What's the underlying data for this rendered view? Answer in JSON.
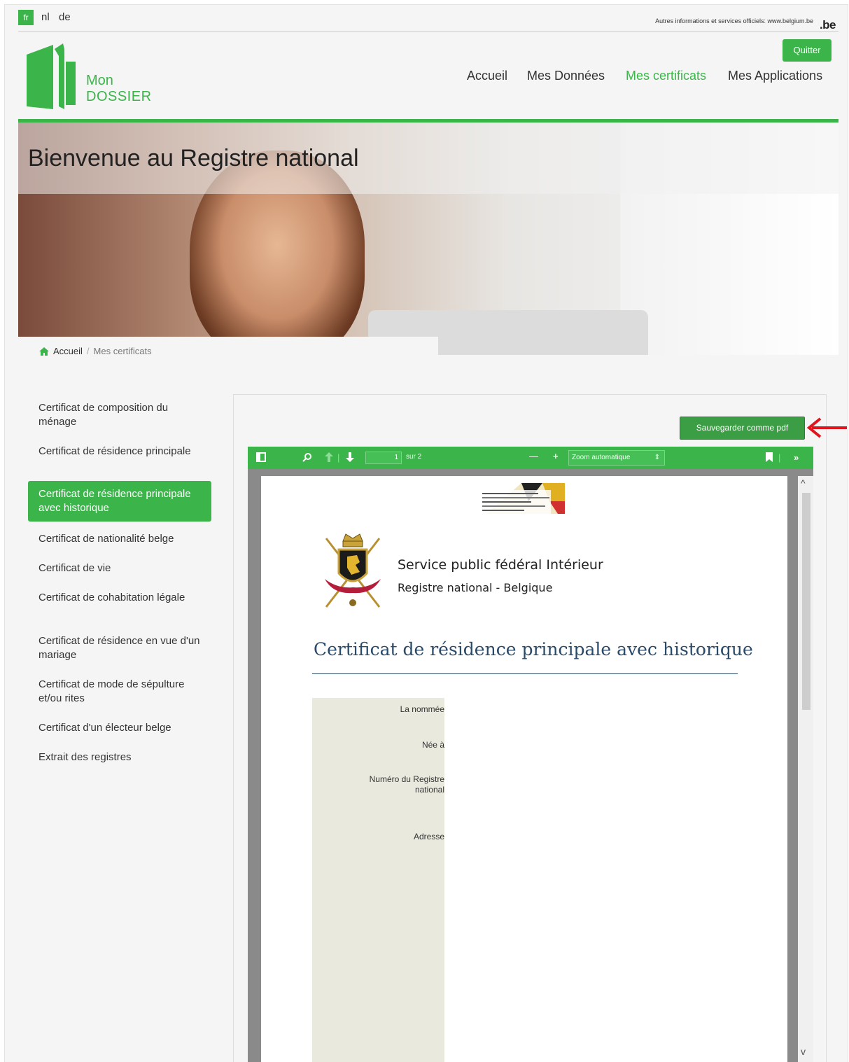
{
  "languages": {
    "active": "fr",
    "others": [
      "nl",
      "de"
    ]
  },
  "official_link": "Autres informations et services officiels: www.belgium.be",
  "be_logo": ".be",
  "logo": {
    "line1": "Mon",
    "line2": "DOSSIER"
  },
  "quit_label": "Quitter",
  "nav": [
    {
      "label": "Accueil",
      "active": false
    },
    {
      "label": "Mes Données",
      "active": false
    },
    {
      "label": "Mes certificats",
      "active": true
    },
    {
      "label": "Mes Applications",
      "active": false
    }
  ],
  "hero_title": "Bienvenue au Registre national",
  "breadcrumb": {
    "home": "Accueil",
    "separator": "/",
    "current": "Mes certificats"
  },
  "sidebar": [
    {
      "label": "Certificat de composition du ménage",
      "active": false
    },
    {
      "label": "Certificat de résidence principale",
      "active": false
    },
    {
      "label": "Certificat de résidence principale avec historique",
      "active": true
    },
    {
      "label": "Certificat de nationalité belge",
      "active": false
    },
    {
      "label": "Certificat de vie",
      "active": false
    },
    {
      "label": "Certificat de cohabitation légale",
      "active": false
    },
    {
      "label": "Certificat de résidence en vue d'un mariage",
      "active": false
    },
    {
      "label": "Certificat de mode de sépulture et/ou rites",
      "active": false
    },
    {
      "label": "Certificat d'un électeur belge",
      "active": false
    },
    {
      "label": "Extrait des registres",
      "active": false
    }
  ],
  "save_pdf_label": "Sauvegarder comme pdf",
  "pdf_toolbar": {
    "page_number": "1",
    "page_of": "sur 2",
    "zoom_value": "Zoom automatique",
    "minus": "—",
    "plus": "+"
  },
  "pdf_document": {
    "organization": "Service public fédéral Intérieur",
    "subtitle": "Registre national - Belgique",
    "title": "Certificat de résidence principale avec historique",
    "fields": [
      "La nommée",
      "Née à",
      "Numéro du Registre national",
      "Adresse"
    ]
  },
  "colors": {
    "brand_green": "#3bb54a",
    "title_blue": "#2a4a6a",
    "arrow_red": "#e0141c"
  }
}
